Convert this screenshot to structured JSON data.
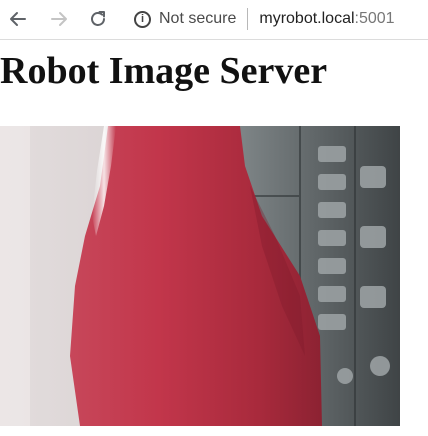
{
  "browser": {
    "security_label": "Not secure",
    "url_host": "myrobot.local",
    "url_port": ":5001",
    "icons": {
      "back": "arrow-left-icon",
      "forward": "arrow-right-icon",
      "reload": "reload-icon",
      "info": "info-icon"
    }
  },
  "page": {
    "title": "Robot Image Server"
  },
  "colors": {
    "object_red": "#c03447",
    "background": "#ffffff"
  }
}
